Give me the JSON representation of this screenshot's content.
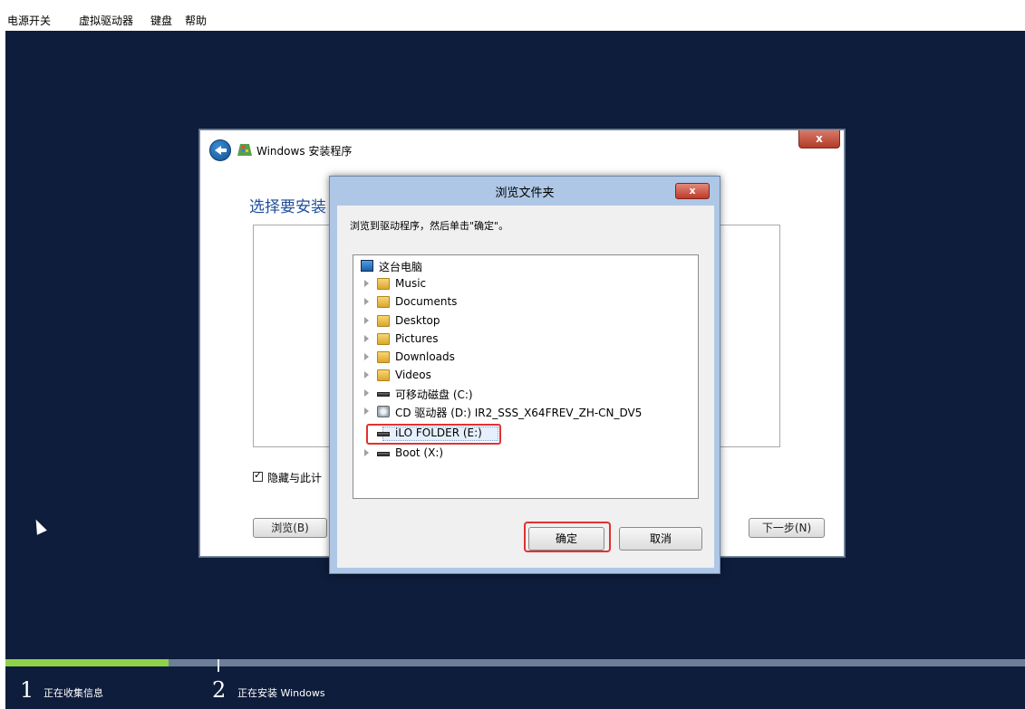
{
  "menubar": {
    "items": [
      "电源开关",
      "虚拟驱动器",
      "键盘",
      "帮助"
    ]
  },
  "setup": {
    "title": "Windows 安装程序",
    "close_label": "x",
    "heading": "选择要安装",
    "hide_label": "隐藏与此计",
    "browse_label": "浏览(B)",
    "next_label": "下一步(N)",
    "checkbox_checked": true
  },
  "browse_dialog": {
    "title": "浏览文件夹",
    "close_label": "x",
    "instruction": "浏览到驱动程序，然后单击\"确定\"。",
    "tree": [
      {
        "label": "这台电脑",
        "icon": "computer-icon",
        "level": 0
      },
      {
        "label": "Music",
        "icon": "music-folder-icon",
        "level": 1
      },
      {
        "label": "Documents",
        "icon": "documents-folder-icon",
        "level": 1
      },
      {
        "label": "Desktop",
        "icon": "desktop-folder-icon",
        "level": 1
      },
      {
        "label": "Pictures",
        "icon": "pictures-folder-icon",
        "level": 1
      },
      {
        "label": "Downloads",
        "icon": "downloads-folder-icon",
        "level": 1
      },
      {
        "label": "Videos",
        "icon": "videos-folder-icon",
        "level": 1
      },
      {
        "label": "可移动磁盘 (C:)",
        "icon": "removable-drive-icon",
        "level": 1
      },
      {
        "label": "CD 驱动器 (D:) IR2_SSS_X64FREV_ZH-CN_DV5",
        "icon": "cd-drive-icon",
        "level": 1
      },
      {
        "label": "iLO FOLDER (E:)",
        "icon": "drive-icon",
        "level": 1,
        "selected": true
      },
      {
        "label": "Boot (X:)",
        "icon": "drive-icon",
        "level": 1
      }
    ],
    "ok_label": "确定",
    "cancel_label": "取消"
  },
  "statusbar": {
    "progress": 0.16,
    "steps": [
      {
        "number": "1",
        "label": "正在收集信息"
      },
      {
        "number": "2",
        "label": "正在安装 Windows"
      }
    ]
  },
  "colors": {
    "desktop": "#0e1d3c",
    "heading": "#1f4e9c",
    "highlight": "#e23131",
    "progress": "#8fd24a"
  }
}
